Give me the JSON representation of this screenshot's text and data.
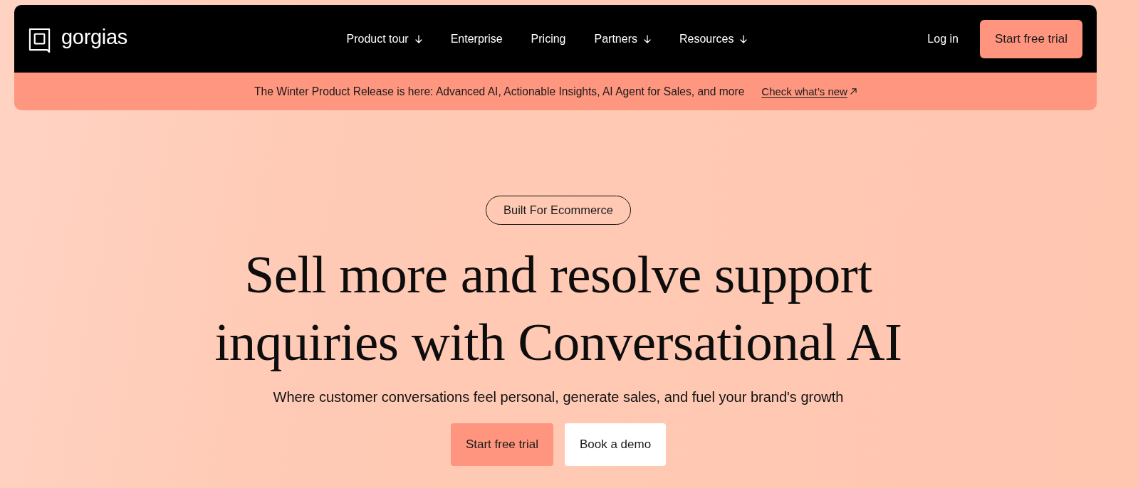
{
  "header": {
    "logo": {
      "name": "gorgias"
    },
    "nav": [
      {
        "label": "Product tour",
        "dropdown": true
      },
      {
        "label": "Enterprise",
        "dropdown": false
      },
      {
        "label": "Pricing",
        "dropdown": false
      },
      {
        "label": "Partners",
        "dropdown": true
      },
      {
        "label": "Resources",
        "dropdown": true
      }
    ],
    "login": "Log in",
    "cta": "Start free trial"
  },
  "banner": {
    "text": "The Winter Product Release is here: Advanced AI, Actionable Insights, AI Agent for Sales, and more",
    "link": "Check what’s new"
  },
  "hero": {
    "badge": "Built For Ecommerce",
    "headline": "Sell more and resolve support inquiries with Conversational AI",
    "subtitle": "Where customer conversations feel personal, generate sales, and fuel your brand's growth",
    "buttons": [
      {
        "label": "Start free trial",
        "kind": "primary"
      },
      {
        "label": "Book a demo",
        "kind": "secondary"
      }
    ]
  }
}
